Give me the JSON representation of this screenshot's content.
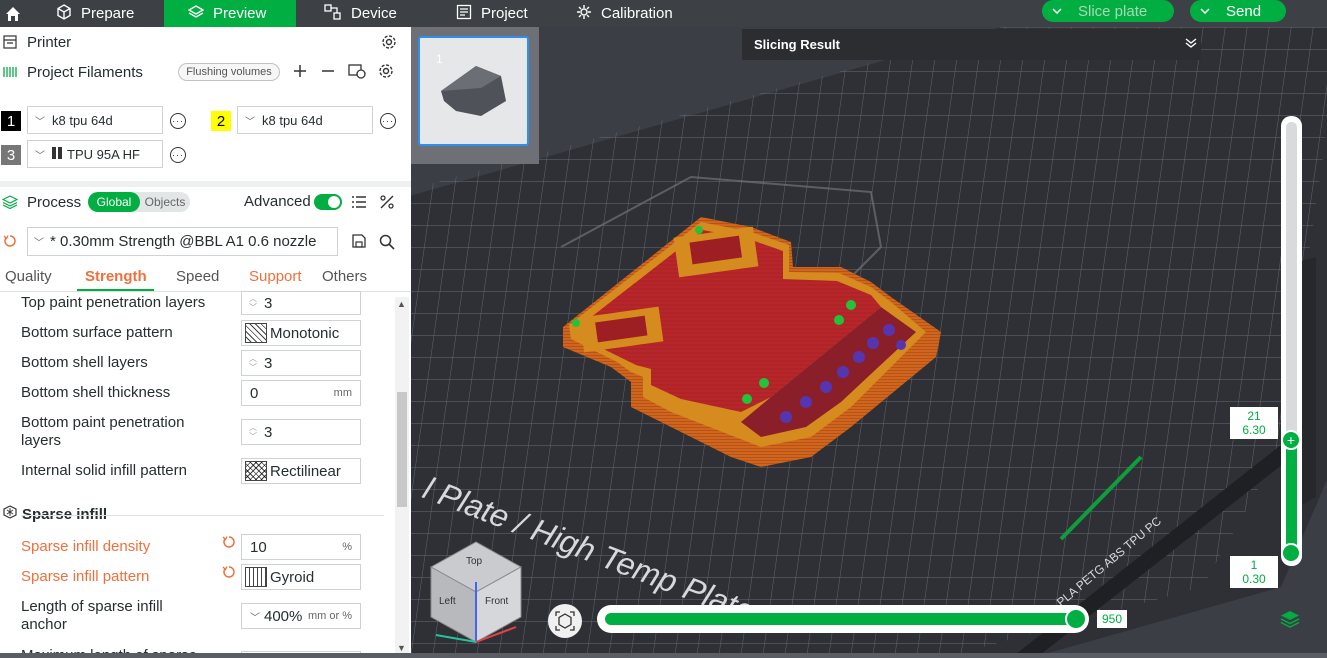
{
  "topbar": {
    "tabs": [
      {
        "label": "Prepare",
        "icon": "cube-icon"
      },
      {
        "label": "Preview",
        "icon": "layers-icon",
        "active": true
      },
      {
        "label": "Device",
        "icon": "device-icon"
      },
      {
        "label": "Project",
        "icon": "project-icon"
      },
      {
        "label": "Calibration",
        "icon": "calibration-icon"
      }
    ],
    "slice_plate": "Slice plate",
    "send": "Send"
  },
  "printer": {
    "title": "Printer"
  },
  "filaments": {
    "title": "Project Filaments",
    "flushing": "Flushing volumes",
    "items": [
      {
        "num": "1",
        "name": "k8 tpu 64d",
        "color": "#000000"
      },
      {
        "num": "2",
        "name": "k8 tpu 64d",
        "color": "#ffff00"
      },
      {
        "num": "3",
        "name": "TPU 95A HF",
        "color": "#777777"
      }
    ]
  },
  "process": {
    "title": "Process",
    "global": "Global",
    "objects": "Objects",
    "advanced": "Advanced",
    "preset": "* 0.30mm Strength @BBL A1 0.6 nozzle",
    "tabs": [
      "Quality",
      "Strength",
      "Speed",
      "Support",
      "Others"
    ]
  },
  "params": {
    "top_paint_penetration": {
      "label": "Top paint penetration layers",
      "value": "3"
    },
    "bottom_surface_pattern": {
      "label": "Bottom surface pattern",
      "value": "Monotonic"
    },
    "bottom_shell_layers": {
      "label": "Bottom shell layers",
      "value": "3"
    },
    "bottom_shell_thickness": {
      "label": "Bottom shell thickness",
      "value": "0",
      "unit": "mm"
    },
    "bottom_paint_penetration": {
      "label1": "Bottom paint penetration",
      "label2": "layers",
      "value": "3"
    },
    "internal_solid_pattern": {
      "label": "Internal solid infill pattern",
      "value": "Rectilinear"
    },
    "sparse_section": "Sparse infill",
    "sparse_density": {
      "label": "Sparse infill density",
      "value": "10",
      "unit": "%"
    },
    "sparse_pattern": {
      "label": "Sparse infill pattern",
      "value": "Gyroid"
    },
    "sparse_anchor": {
      "label1": "Length of sparse infill",
      "label2": "anchor",
      "value": "400%",
      "unit": "mm or %"
    },
    "max_length": {
      "label": "Maximum length of sparse"
    }
  },
  "viewport": {
    "thumb_num": "1",
    "slicing_result": "Slicing Result",
    "plate_text": "l Plate / High Temp Plate",
    "plate_side_text": "PLA PETG ABS TPU PC",
    "h_value": "950",
    "v_top_layer": "21",
    "v_top_height": "6.30",
    "v_bottom_layer": "1",
    "v_bottom_height": "0.30",
    "cube_top": "Top",
    "cube_left": "Left",
    "cube_front": "Front"
  },
  "colors": {
    "accent": "#00ae42",
    "orange": "#f0703d",
    "bed": "#3b3e45"
  }
}
